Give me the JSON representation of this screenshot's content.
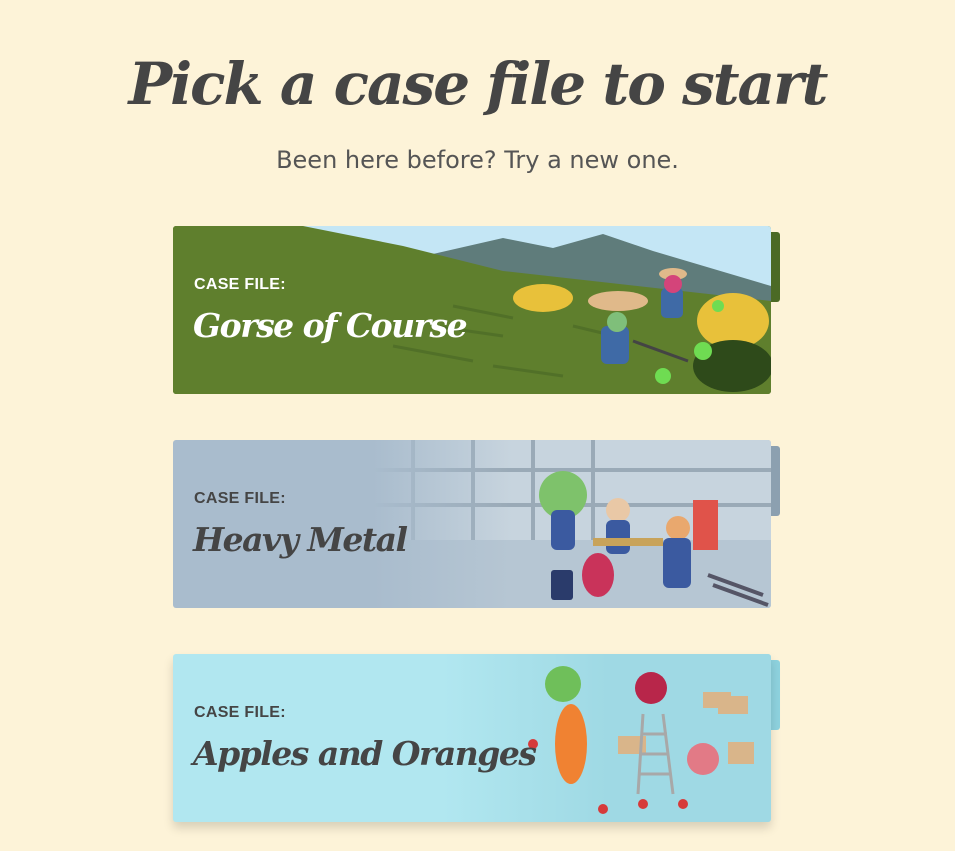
{
  "header": {
    "title": "Pick a case file to start",
    "subtitle": "Been here before? Try a new one."
  },
  "cards": [
    {
      "label": "CASE FILE:",
      "name": "Gorse of Course",
      "bg": "#5b7b2e",
      "tab": "#4b6a25",
      "text": "#ffffff",
      "icon": "farmer-scene-illustration"
    },
    {
      "label": "CASE FILE:",
      "name": "Heavy Metal",
      "bg": "#a9bccd",
      "tab": "#8ca0b0",
      "text": "#454545",
      "icon": "warehouse-scene-illustration"
    },
    {
      "label": "CASE FILE:",
      "name": "Apples and Oranges",
      "bg": "#b1e7f0",
      "tab": "#8ed2de",
      "text": "#454545",
      "icon": "fruit-warehouse-scene-illustration"
    }
  ]
}
